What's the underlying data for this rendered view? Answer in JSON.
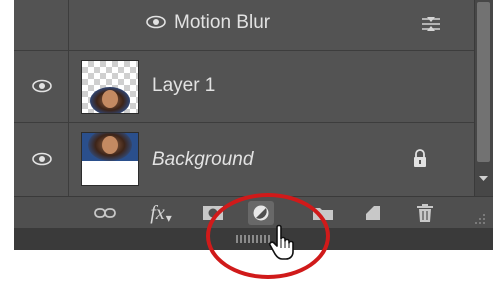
{
  "layers": [
    {
      "name": "Motion Blur",
      "type": "filter-effect"
    },
    {
      "name": "Layer 1",
      "type": "layer"
    },
    {
      "name": "Background",
      "type": "background",
      "locked": true
    }
  ],
  "footer_buttons": [
    {
      "id": "link",
      "icon": "link-icon"
    },
    {
      "id": "fx",
      "icon": "fx-icon",
      "label": "fx"
    },
    {
      "id": "mask",
      "icon": "layer-mask-icon"
    },
    {
      "id": "adjustment",
      "icon": "adjustment-layer-icon",
      "highlighted": true
    },
    {
      "id": "group",
      "icon": "folder-icon"
    },
    {
      "id": "new-layer",
      "icon": "new-layer-icon"
    },
    {
      "id": "delete",
      "icon": "trash-icon"
    }
  ],
  "colors": {
    "panel": "#535353",
    "highlight_circle": "#d01a1a"
  }
}
